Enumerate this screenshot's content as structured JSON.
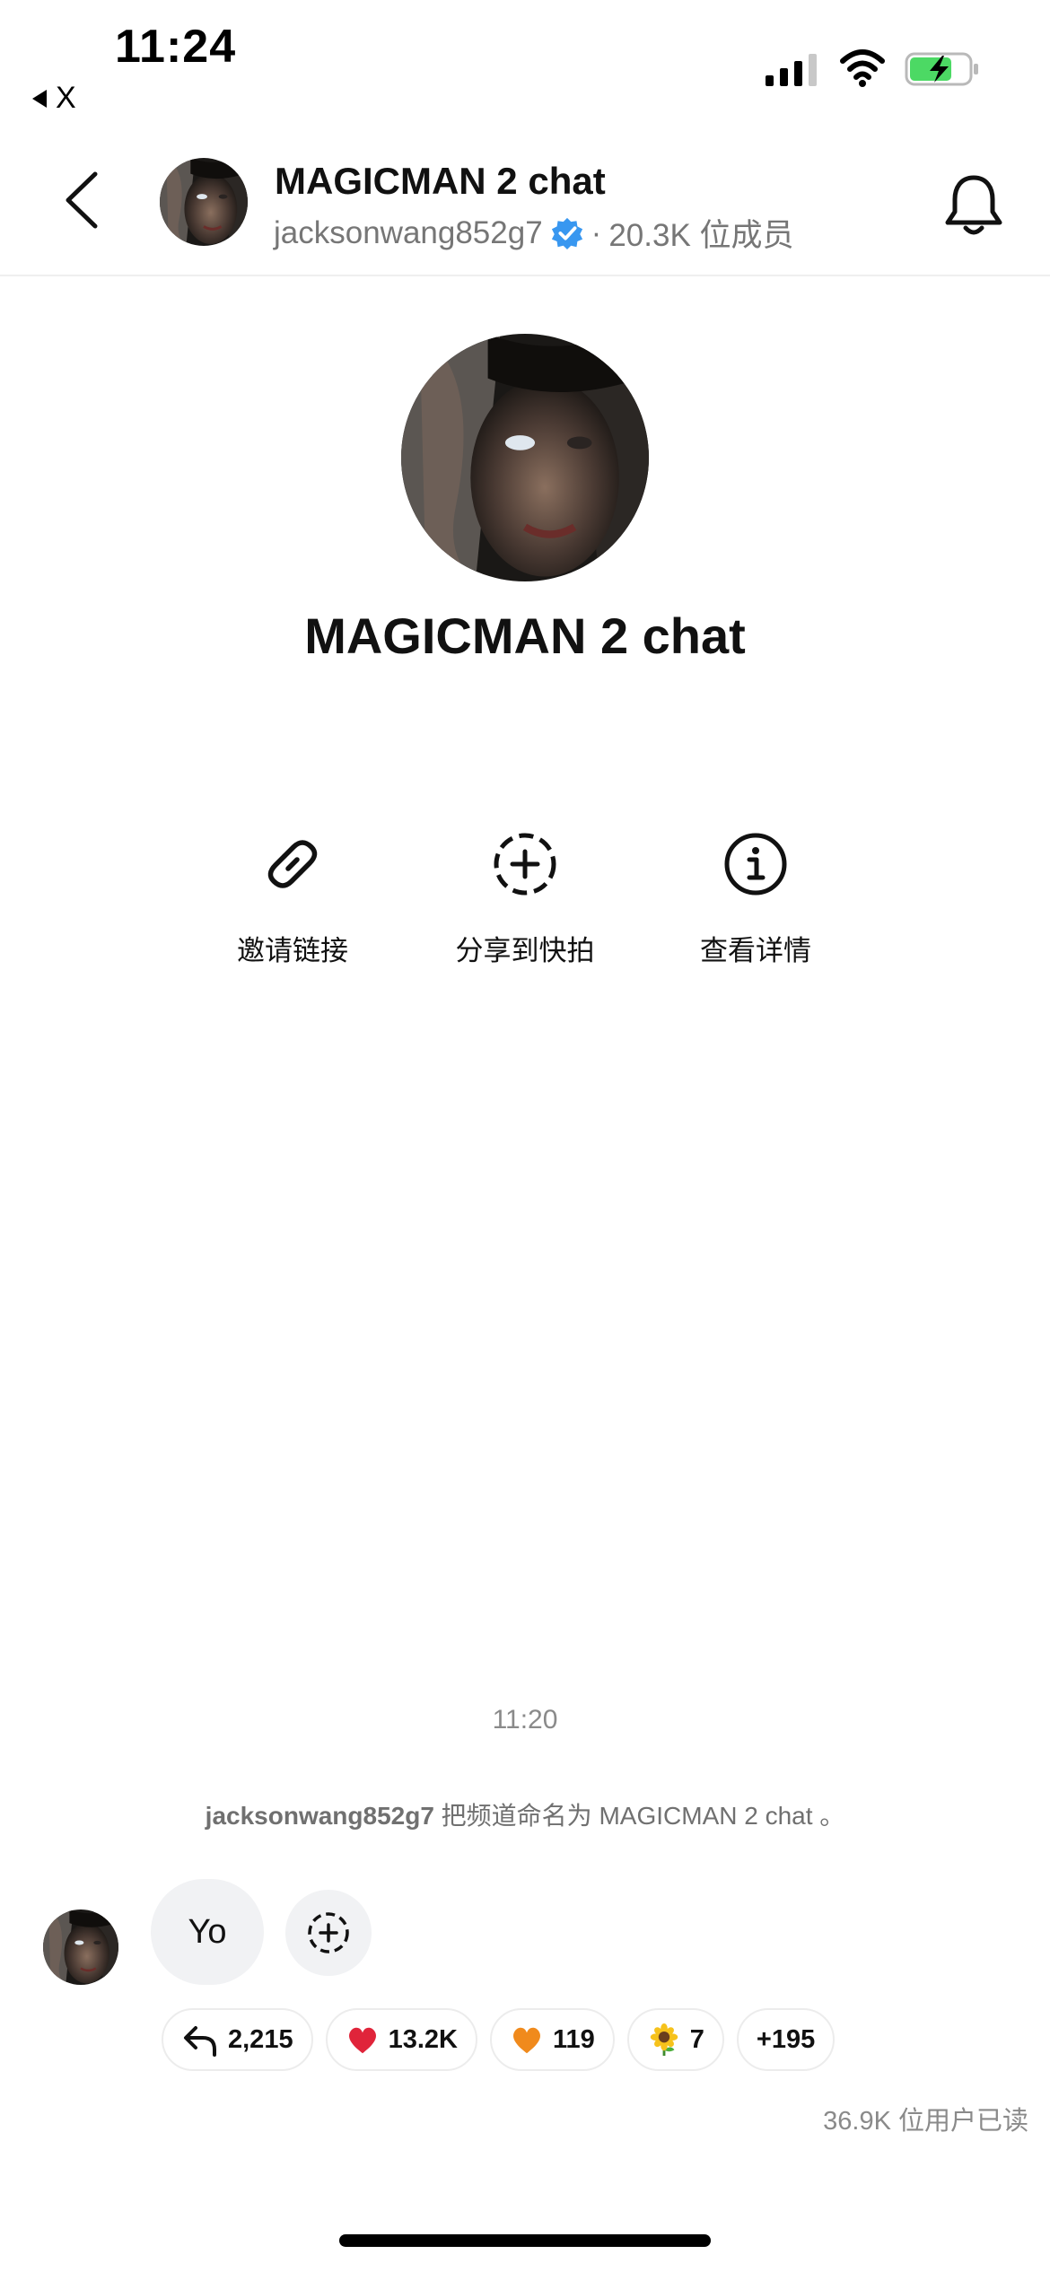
{
  "status_bar": {
    "time": "11:24",
    "back_app_label": "X"
  },
  "header": {
    "title": "MAGICMAN 2 chat",
    "handle": "jacksonwang852g7",
    "separator": "·",
    "members": "20.3K 位成员"
  },
  "hero": {
    "title": "MAGICMAN 2 chat"
  },
  "actions": [
    {
      "label": "邀请链接",
      "icon": "link-icon"
    },
    {
      "label": "分享到快拍",
      "icon": "add-story-icon"
    },
    {
      "label": "查看详情",
      "icon": "info-icon"
    }
  ],
  "chat": {
    "timestamp": "11:20",
    "system_message": {
      "user": "jacksonwang852g7",
      "text": " 把频道命名为 MAGICMAN 2 chat 。"
    },
    "message": {
      "text": "Yo"
    },
    "reactions": {
      "replies": "2,215",
      "heart": "13.2K",
      "orange_heart": "119",
      "sunflower": "7",
      "more": "+195"
    },
    "read_count": "36.9K 位用户已读"
  },
  "colors": {
    "verified_badge": "#3897f0",
    "heart": "#e0243a",
    "orange_heart": "#f08a1c",
    "sunflower_petals": "#f6c21b",
    "battery_fill": "#4cd964",
    "secondary_text": "#767676"
  }
}
